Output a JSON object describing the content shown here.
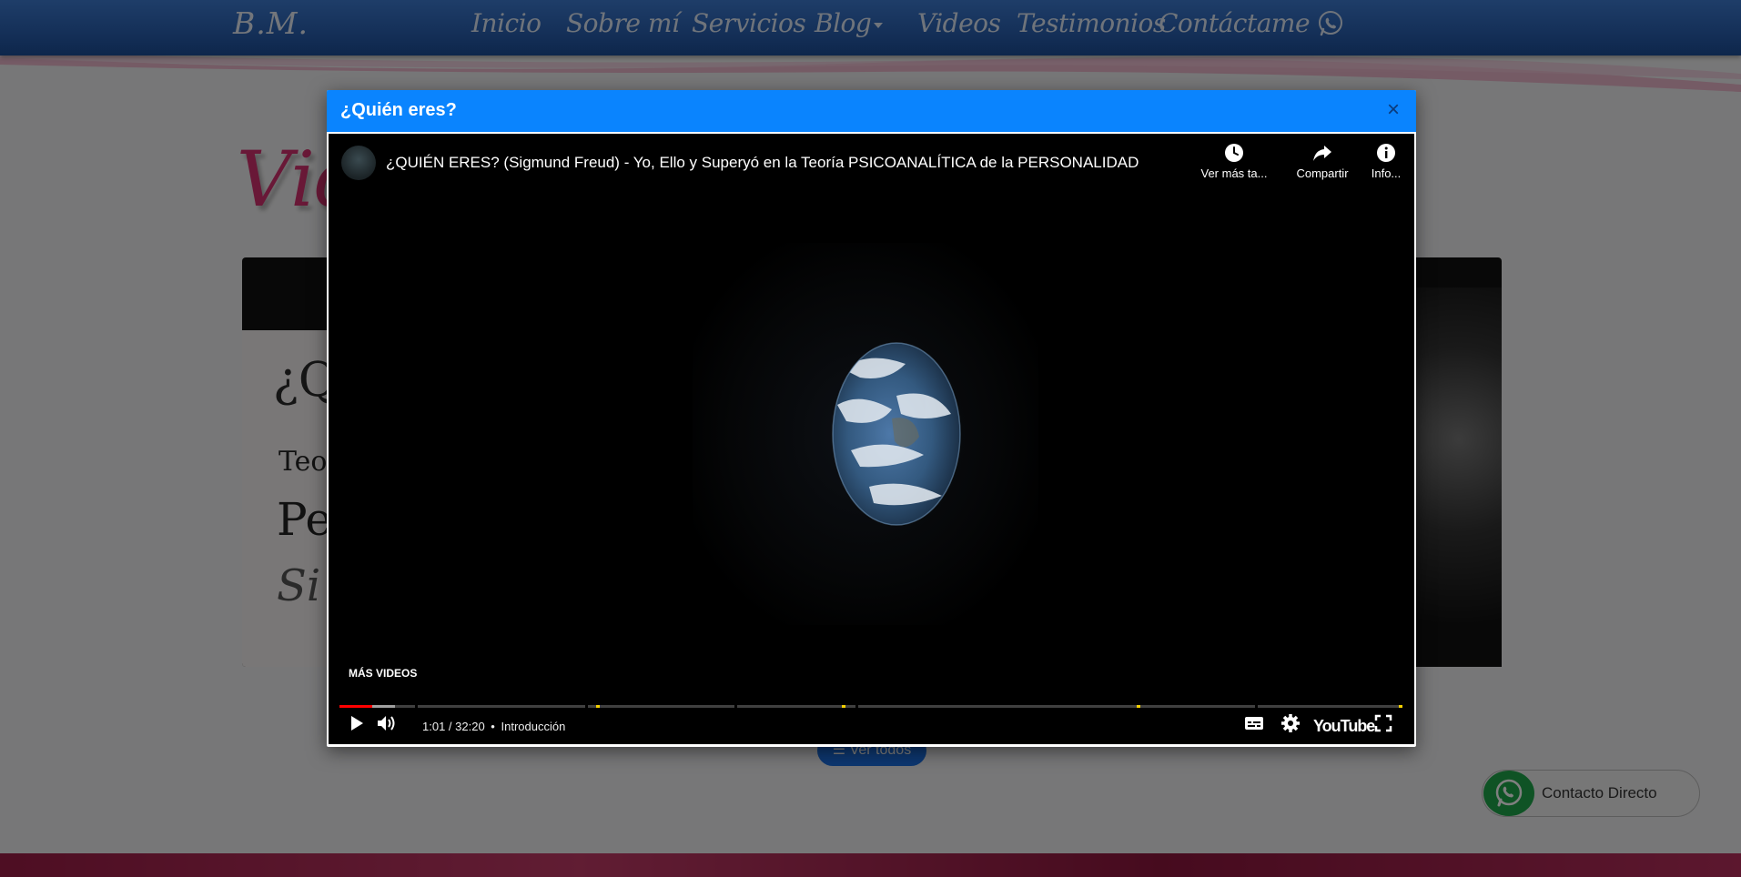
{
  "navbar": {
    "brand": "B.M.",
    "items": [
      {
        "label": "Inicio"
      },
      {
        "label": "Sobre mí"
      },
      {
        "label": "Servicios"
      },
      {
        "label": "Blog"
      },
      {
        "label": "Videos"
      },
      {
        "label": "Testimonios"
      },
      {
        "label": "Contáctame"
      }
    ],
    "whatsapp_icon": "whatsapp-icon"
  },
  "page": {
    "section_title": "Vide",
    "thumbnail": {
      "line1": "¿Q",
      "line2": "Teo",
      "line3": "Pe",
      "line4": "Si"
    },
    "view_all_label": "Ver todos",
    "contact_label": "Contacto Directo"
  },
  "modal": {
    "title": "¿Quién eres?",
    "close_label": "×",
    "player": {
      "video_title": "¿QUIÉN ERES? (Sigmund Freud) - Yo, Ello y Superyó en la Teoría PSICOANALÍTICA de la PERSONALIDAD",
      "watch_later_label": "Ver más ta...",
      "share_label": "Compartir",
      "info_label": "Info...",
      "more_videos_label": "MÁS VIDEOS",
      "current_time": "1:01",
      "duration": "32:20",
      "time_display": "1:01 / 32:20",
      "chapter_separator": "•",
      "chapter": "Introducción",
      "played_fraction": 0.031,
      "buffered_fraction": 0.052,
      "logo_text": "YouTube"
    }
  },
  "colors": {
    "nav_bg": "#2b62b3",
    "modal_header": "#0a84fe",
    "accent_pink": "#d2306f",
    "progress_red": "#ff0000",
    "chapter_yellow": "#f5d100",
    "whatsapp_green": "#1fa64a"
  }
}
